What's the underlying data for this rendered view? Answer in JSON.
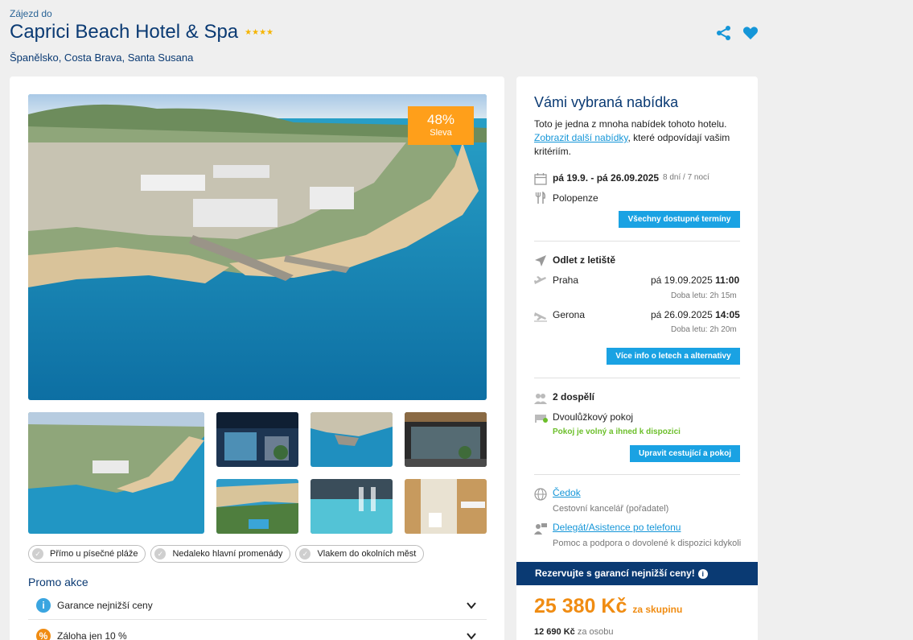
{
  "header": {
    "breadcrumb": "Zájezd do",
    "title": "Caprici Beach Hotel & Spa",
    "stars": "★★★★",
    "location": "Španělsko, Costa Brava, Santa Susana",
    "icons": [
      "share-icon",
      "heart-icon"
    ]
  },
  "gallery": {
    "discount_value": "48%",
    "discount_label": "Sleva"
  },
  "tags": [
    "Přímo u písečné pláže",
    "Nedaleko hlavní promenády",
    "Vlakem do okolních měst"
  ],
  "promo": {
    "title": "Promo akce",
    "items": [
      {
        "label": "Garance nejnižší ceny",
        "icon": "info-icon",
        "color": "#3aa5e0"
      },
      {
        "label": "Záloha jen 10 %",
        "icon": "percent-icon",
        "color": "#f08c12"
      }
    ]
  },
  "offer": {
    "title": "Vámi vybraná nabídka",
    "intro_text": "Toto je jedna z mnoha nabídek tohoto hotelu.",
    "intro_link": "Zobrazit další nabídky",
    "intro_rest": ", které odpovídají vašim kritériím.",
    "dates": "pá 19.9. - pá 26.09.2025",
    "duration": "8 dní / 7 nocí",
    "board": "Polopenze",
    "all_dates_button": "Všechny dostupné termíny",
    "departure_label": "Odlet z letiště",
    "outbound_from": "Praha",
    "outbound_date": "pá 19.09.2025",
    "outbound_time": "11:00",
    "outbound_duration": "Doba letu: 2h 15m",
    "return_from": "Gerona",
    "return_date": "pá 26.09.2025",
    "return_time": "14:05",
    "return_duration": "Doba letu: 2h 20m",
    "flights_button": "Více info o letech a alternativy",
    "travelers": "2 dospělí",
    "room": "Dvoulůžkový pokoj",
    "room_status": "Pokoj je volný a ihned k dispozici",
    "edit_button": "Upravit cestující a pokoj",
    "organizer_link": "Čedok",
    "organizer_desc": "Cestovní kancelář (pořadatel)",
    "delegate_link": "Delegát/Asistence po telefonu",
    "delegate_desc": "Pomoc a podpora o dovolené k dispozici kdykoli",
    "guarantee_bar": "Rezervujte s garancí nejnižší ceny!",
    "price": "25 380 Kč",
    "price_suffix": "za skupinu",
    "per_person_price": "12 690 Kč",
    "per_person_label": "za osobu"
  },
  "colors": {
    "brand": "#0a3a73",
    "accent": "#1aa2e3",
    "discount": "#ff9f1a",
    "price": "#f08c12",
    "available": "#6cbf2a"
  }
}
